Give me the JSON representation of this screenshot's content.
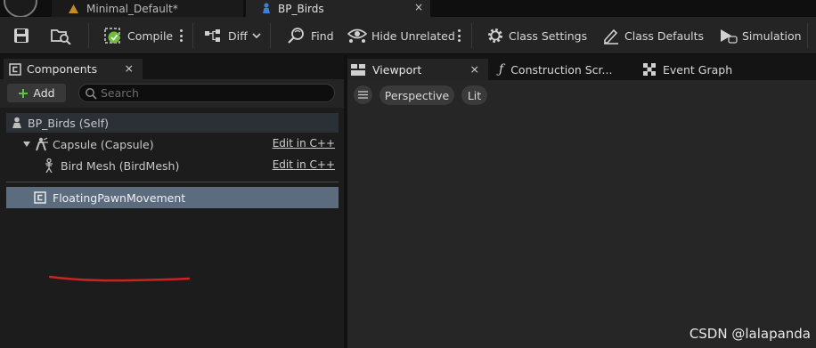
{
  "tabs": {
    "map_tab": "Minimal_Default*",
    "blueprint_tab": "BP_Birds",
    "close_glyph": "×"
  },
  "toolbar": {
    "compile": "Compile",
    "diff": "Diff",
    "find": "Find",
    "hide_unrelated": "Hide Unrelated",
    "class_settings": "Class Settings",
    "class_defaults": "Class Defaults",
    "simulation": "Simulation"
  },
  "components_panel": {
    "title": "Components",
    "add_label": "Add",
    "search_placeholder": "Search",
    "tree": {
      "self": "BP_Birds (Self)",
      "capsule": "Capsule (Capsule)",
      "mesh": "Bird Mesh (BirdMesh)",
      "movement": "FloatingPawnMovement",
      "edit_link": "Edit in C++"
    }
  },
  "editor_tabs": {
    "viewport": "Viewport",
    "construction": "Construction Scr...",
    "event_graph": "Event Graph"
  },
  "viewport": {
    "perspective": "Perspective",
    "lit": "Lit"
  },
  "watermark": "CSDN @lalapanda",
  "colors": {
    "selection": "#5b6c7f",
    "annotation": "#cc2222",
    "compile_ok": "#6fbf3a",
    "add_plus": "#63c04a",
    "map_tab_icon": "#c98a22",
    "blueprint_tab_icon": "#3d7fd6"
  }
}
